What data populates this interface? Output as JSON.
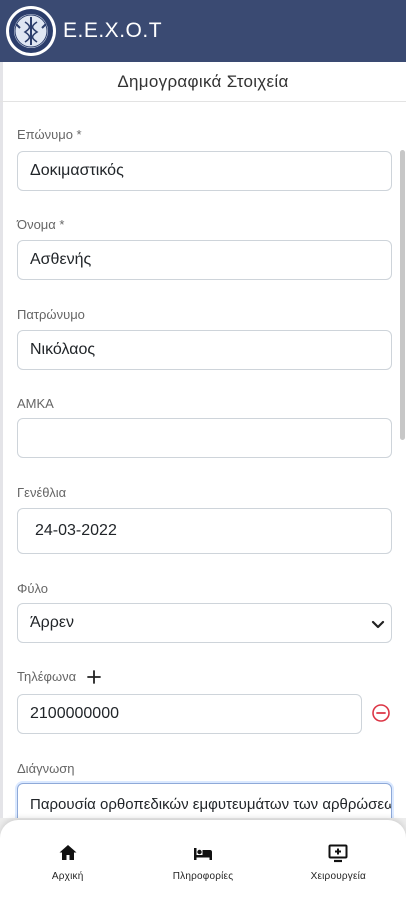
{
  "header": {
    "app_title": "Ε.Ε.Χ.Ο.Τ",
    "logo_icon": "emblem-logo",
    "color": "#3a4a72"
  },
  "section_title": "Δημογραφικά Στοιχεία",
  "form": {
    "surname": {
      "label": "Επώνυμο *",
      "value": "Δοκιμαστικός"
    },
    "name": {
      "label": "Όνομα *",
      "value": "Ασθενής"
    },
    "fathers_name": {
      "label": "Πατρώνυμο",
      "value": "Νικόλαος"
    },
    "amka": {
      "label": "ΑΜΚΑ",
      "value": ""
    },
    "birthdate": {
      "label": "Γενέθλια",
      "value": "24-03-2022"
    },
    "gender": {
      "label": "Φύλο",
      "value": "Άρρεν"
    },
    "phones": {
      "label": "Τηλέφωνα",
      "value": "2100000000",
      "add_icon": "plus-icon",
      "remove_icon": "minus-circle-icon",
      "remove_color": "#dc3545"
    },
    "diagnosis": {
      "label": "Διάγνωση",
      "value": "Παρουσία ορθοπεδικών εμφυτευμάτων των αρθρώσεων"
    }
  },
  "bottom_nav": [
    {
      "label": "Αρχική",
      "icon": "home-icon"
    },
    {
      "label": "Πληροφορίες",
      "icon": "bed-icon"
    },
    {
      "label": "Χειρουργεία",
      "icon": "monitor-plus-icon"
    }
  ]
}
